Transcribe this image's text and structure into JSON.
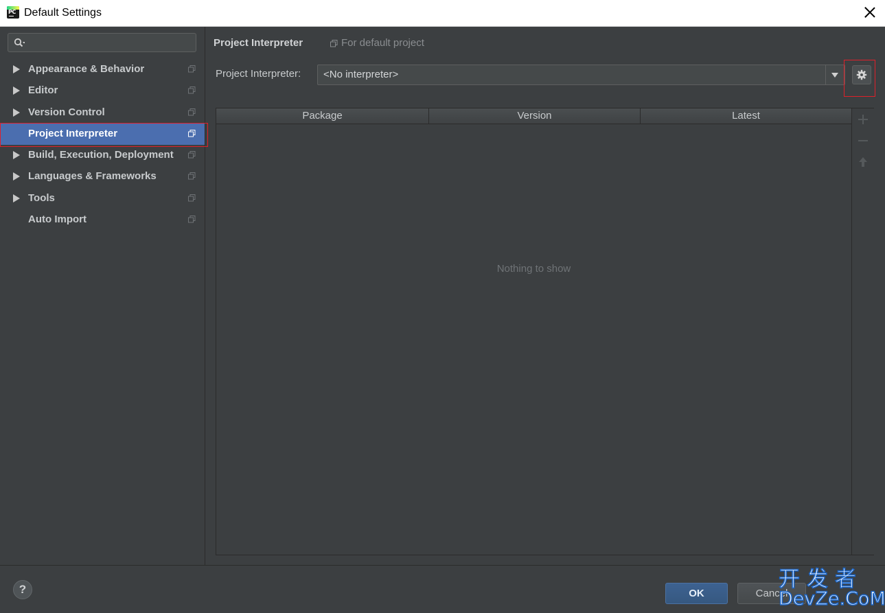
{
  "window": {
    "title": "Default Settings",
    "app_icon_text": "PC"
  },
  "sidebar": {
    "search_placeholder": "",
    "items": [
      {
        "label": "Appearance & Behavior",
        "expandable": true,
        "selected": false
      },
      {
        "label": "Editor",
        "expandable": true,
        "selected": false
      },
      {
        "label": "Version Control",
        "expandable": true,
        "selected": false
      },
      {
        "label": "Project Interpreter",
        "expandable": false,
        "selected": true
      },
      {
        "label": "Build, Execution, Deployment",
        "expandable": true,
        "selected": false
      },
      {
        "label": "Languages & Frameworks",
        "expandable": true,
        "selected": false
      },
      {
        "label": "Tools",
        "expandable": true,
        "selected": false
      },
      {
        "label": "Auto Import",
        "expandable": false,
        "selected": false
      }
    ]
  },
  "main": {
    "title": "Project Interpreter",
    "scope_label": "For default project",
    "interpreter_label": "Project Interpreter:",
    "interpreter_value": "<No interpreter>",
    "table": {
      "columns": [
        "Package",
        "Version",
        "Latest"
      ],
      "rows": [],
      "empty_text": "Nothing to show"
    },
    "tools": [
      "plus-icon",
      "minus-icon",
      "upgrade-arrow-icon"
    ]
  },
  "footer": {
    "help_label": "?",
    "ok_label": "OK",
    "cancel_label": "Cancel"
  },
  "watermark": {
    "line1": "开发者",
    "line2": "DevZe.CoM"
  },
  "colors": {
    "selection": "#4b6eaf",
    "highlight_outline": "#e0202a",
    "background": "#3c3f41",
    "ok_button": "#3d6291"
  }
}
